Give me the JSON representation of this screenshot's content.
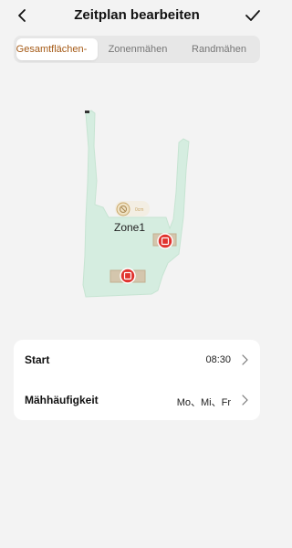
{
  "header": {
    "title": "Zeitplan bearbeiten"
  },
  "tabs": [
    {
      "label": "Gesamtflächen-",
      "active": true
    },
    {
      "label": "Zonenmähen",
      "active": false
    },
    {
      "label": "Randmähen",
      "active": false
    }
  ],
  "map": {
    "zone_label": "Zone1",
    "dock_label": "0cm",
    "colors": {
      "lawn": "#d5ede0",
      "marker": "#e0342f",
      "obstacle": "#d4c6ad"
    }
  },
  "schedule": {
    "start_label": "Start",
    "start_value": "08:30",
    "frequency_label": "Mähhäufigkeit",
    "frequency_value": "Mo、Mi、Fr"
  },
  "colors": {
    "accent": "#a55a16",
    "background": "#f3f3f3"
  }
}
